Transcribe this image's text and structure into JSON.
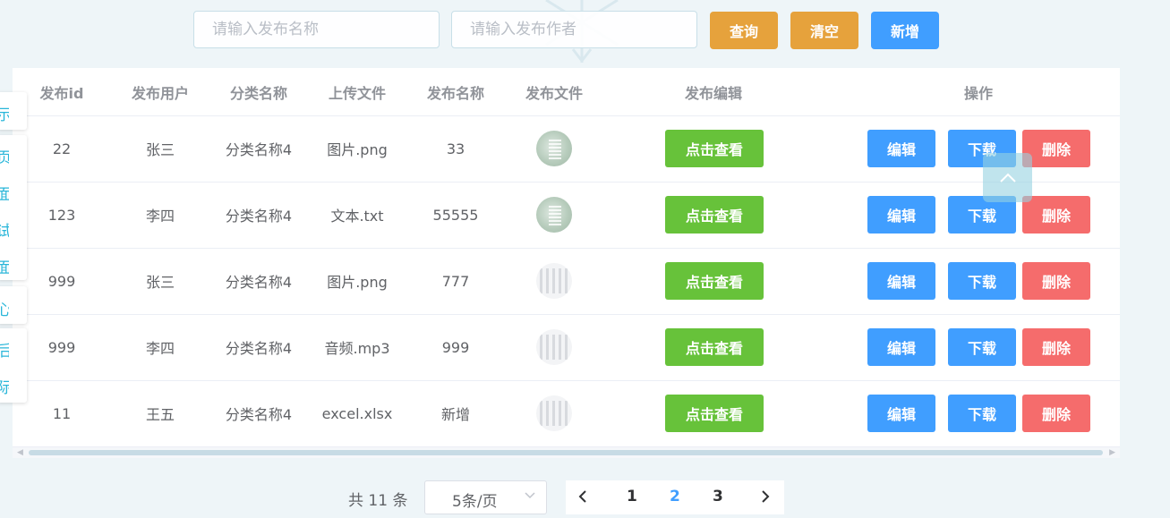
{
  "search": {
    "name_placeholder": "请输入发布名称",
    "author_placeholder": "请输入发布作者",
    "query_label": "查询",
    "clear_label": "清空",
    "add_label": "新增"
  },
  "colors": {
    "query": "#e6a23c",
    "clear": "#e6a23c",
    "add": "#409eff",
    "view": "#67c23a",
    "edit": "#409eff",
    "download": "#409eff",
    "delete": "#f56c6c",
    "active_page": "#409eff"
  },
  "table": {
    "headers": [
      "发布id",
      "发布用户",
      "分类名称",
      "上传文件",
      "发布名称",
      "发布文件",
      "发布编辑",
      "操作"
    ],
    "view_label": "点击查看",
    "edit_label": "编辑",
    "download_label": "下载",
    "delete_label": "删除",
    "rows": [
      {
        "id": "22",
        "user": "张三",
        "category": "分类名称4",
        "file": "图片.png",
        "name": "33",
        "thumb": "image-thumb"
      },
      {
        "id": "123",
        "user": "李四",
        "category": "分类名称4",
        "file": "文本.txt",
        "name": "55555",
        "thumb": "image-thumb"
      },
      {
        "id": "999",
        "user": "张三",
        "category": "分类名称4",
        "file": "图片.png",
        "name": "777",
        "thumb": "text-thumb"
      },
      {
        "id": "999",
        "user": "李四",
        "category": "分类名称4",
        "file": "音频.mp3",
        "name": "999",
        "thumb": "text-thumb"
      },
      {
        "id": "11",
        "user": "王五",
        "category": "分类名称4",
        "file": "excel.xlsx",
        "name": "新增",
        "thumb": "text-thumb"
      }
    ]
  },
  "side_menu": {
    "chars": [
      "示",
      "页",
      "面",
      "试",
      "面",
      "心",
      "后",
      "际"
    ]
  },
  "pagination": {
    "total_text": "共 11 条",
    "page_size": "5条/页",
    "pages": [
      "1",
      "2",
      "3"
    ],
    "current_page": "2"
  },
  "icons": {
    "back_to_top": "chevron-up-icon",
    "prev": "chevron-left-icon",
    "next": "chevron-right-icon",
    "select": "chevron-down-icon"
  }
}
